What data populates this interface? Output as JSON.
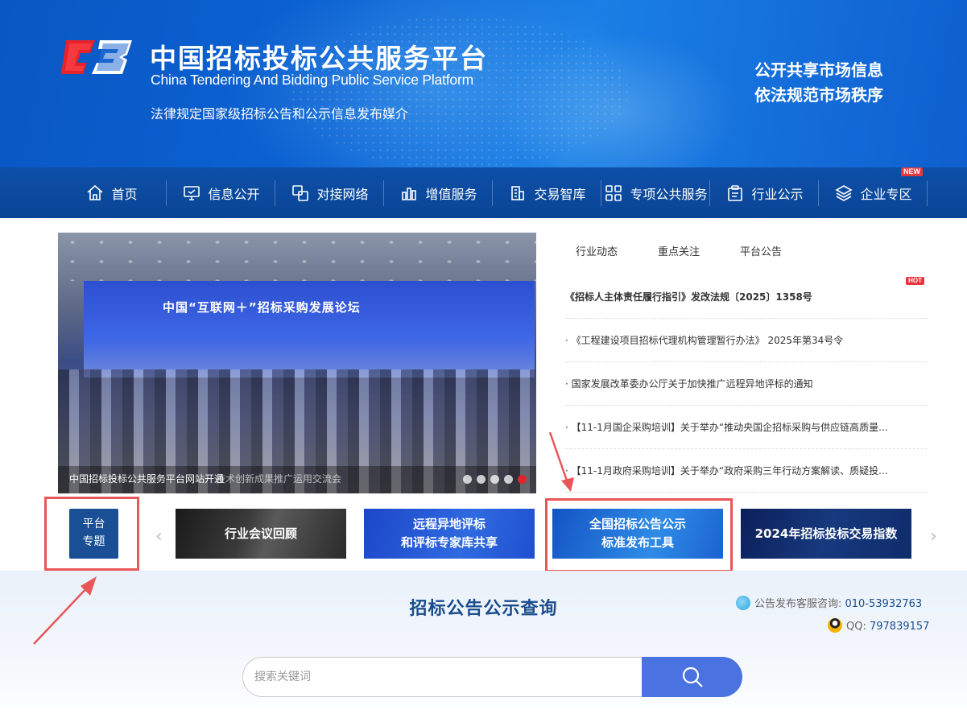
{
  "header": {
    "title_cn": "中国招标投标公共服务平台",
    "title_en": "China Tendering And Bidding Public Service Platform",
    "subtitle": "法律规定国家级招标公告和公示信息发布媒介",
    "slogan_line1": "公开共享市场信息",
    "slogan_line2": "依法规范市场秩序"
  },
  "nav": {
    "items": [
      {
        "label": "首页",
        "icon": "home-icon"
      },
      {
        "label": "信息公开",
        "icon": "monitor-icon"
      },
      {
        "label": "对接网络",
        "icon": "link-icon"
      },
      {
        "label": "增值服务",
        "icon": "bar-chart-icon"
      },
      {
        "label": "交易智库",
        "icon": "building-icon"
      },
      {
        "label": "专项公共服务",
        "icon": "grid-icon"
      },
      {
        "label": "行业公示",
        "icon": "clipboard-icon"
      },
      {
        "label": "企业专区",
        "icon": "layers-icon"
      }
    ],
    "new_badge": "NEW"
  },
  "slider": {
    "stage_text": "中国“互联网＋”招标采购发展论坛",
    "caption": "中国招标投标公共服务平台网站开通",
    "caption_overlap": "技术创新成果推广运用交流会",
    "total_dots": 5,
    "active_dot": 5
  },
  "news": {
    "tabs": [
      "行业动态",
      "重点关注",
      "平台公告"
    ],
    "hot_badge": "HOT",
    "items": [
      "《招标人主体责任履行指引》发改法规〔2025〕1358号",
      "· 《工程建设项目招标代理机构管理暂行办法》 2025年第34号令",
      "· 国家发展改革委办公厅关于加快推广远程异地评标的通知",
      "· 【11-1月国企采购培训】关于举办“推动央国企招标采购与供应链高质量...",
      "· 【11-1月政府采购培训】关于举办“政府采购三年行动方案解读、质疑投..."
    ]
  },
  "topics": {
    "label_line1": "平台",
    "label_line2": "专题",
    "items": [
      {
        "line1": "行业会议回顾",
        "line2": ""
      },
      {
        "line1": "远程异地评标",
        "line2": "和评标专家库共享"
      },
      {
        "line1": "全国招标公告公示",
        "line2": "标准发布工具"
      },
      {
        "line1": "2024年招标投标交易指数",
        "line2": ""
      }
    ],
    "prev": "‹",
    "next": "›"
  },
  "search": {
    "title": "招标公告公示查询",
    "placeholder": "搜索关键词",
    "phone_label": "公告发布客服咨询: ",
    "phone": "010-53932763",
    "qq_label": "QQ: ",
    "qq": "797839157"
  },
  "colors": {
    "banner_blue": "#0c62d3",
    "nav_blue": "#0b4a9e",
    "title_blue": "#1a4d8f",
    "search_btn": "#4a72e0",
    "annotation_red": "#e85658"
  }
}
